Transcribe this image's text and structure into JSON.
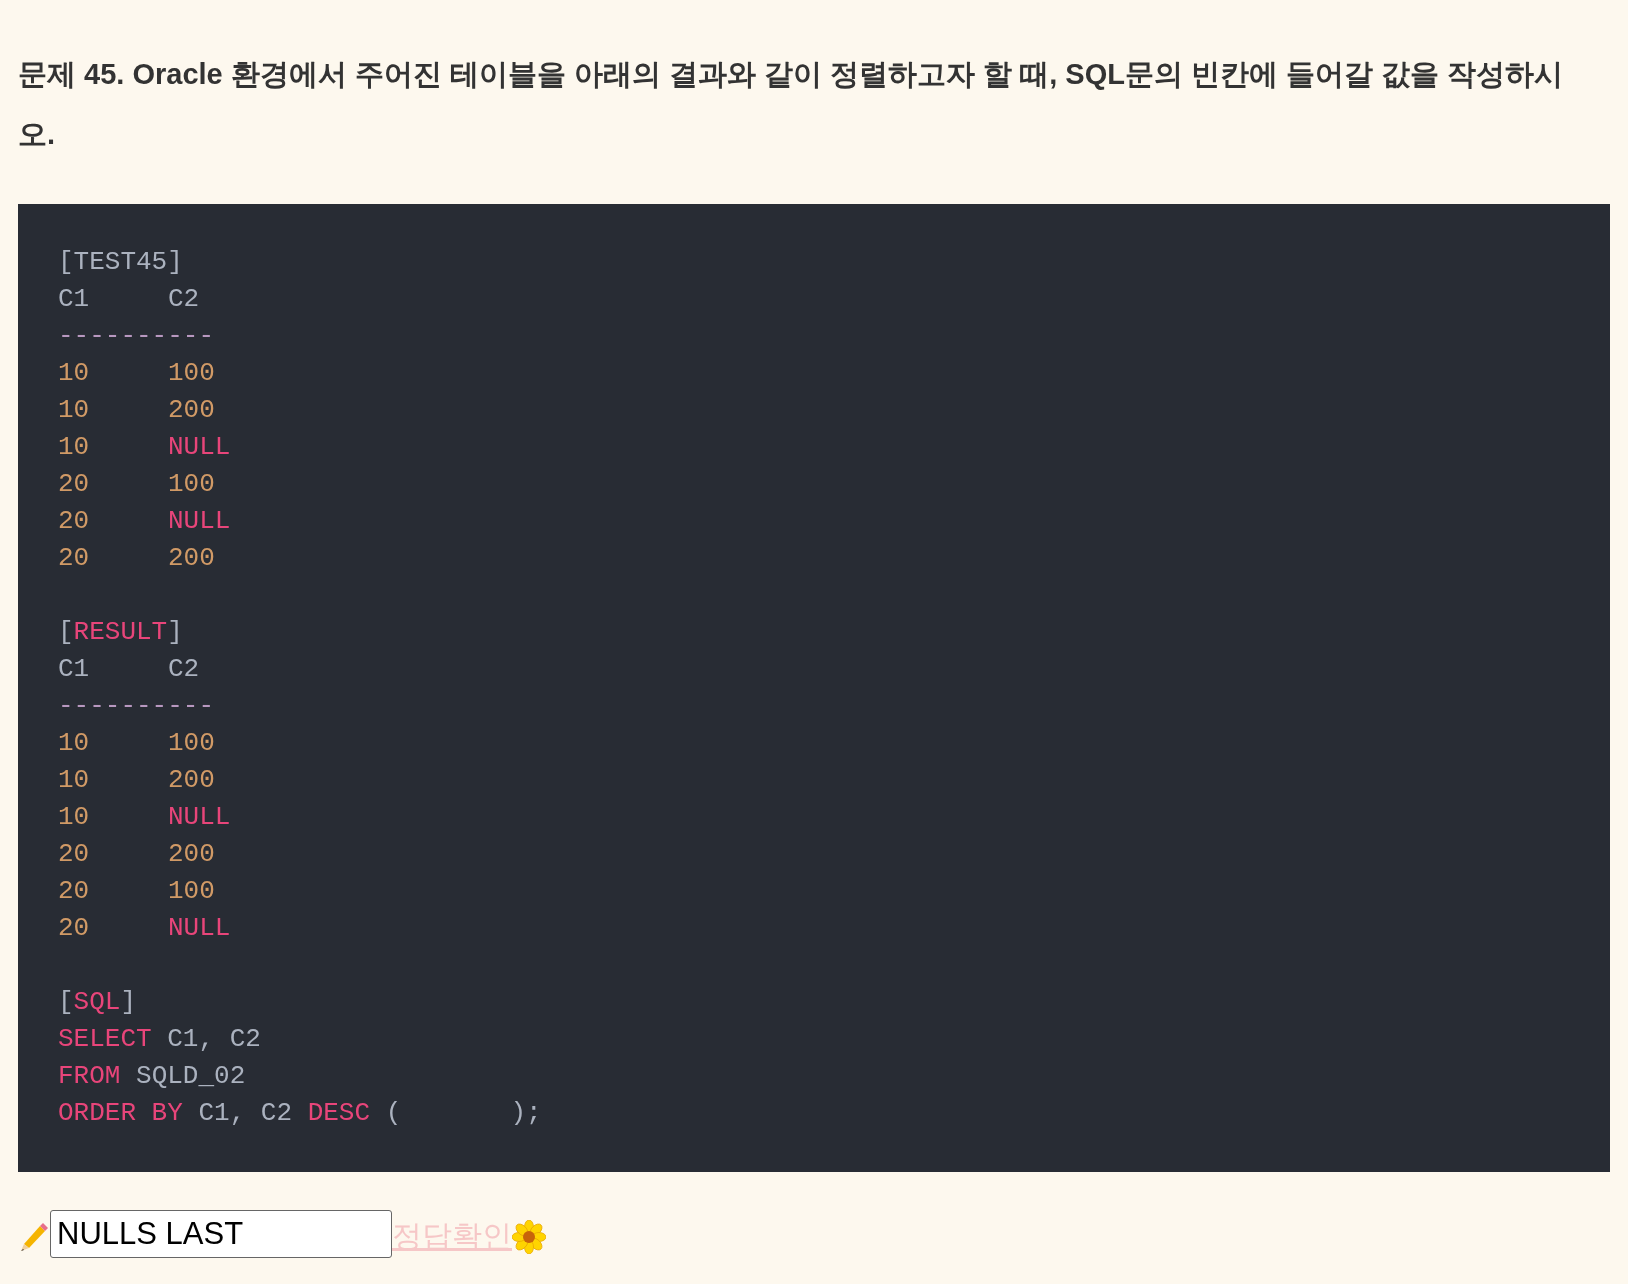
{
  "question": "문제 45. Oracle 환경에서 주어진 테이블을 아래의 결과와 같이 정렬하고자 할 때, SQL문의 빈칸에 들어갈 값을 작성하시오.",
  "sections": [
    {
      "kind": "table",
      "title": [
        {
          "text": "[",
          "kind": "plain"
        },
        {
          "text": "TEST45",
          "kind": "plain"
        },
        {
          "text": "]",
          "kind": "plain"
        }
      ],
      "columns": [
        "C1",
        "C2"
      ],
      "divider": "----------",
      "rows": [
        [
          {
            "text": "10",
            "kind": "number"
          },
          {
            "text": "100",
            "kind": "number"
          }
        ],
        [
          {
            "text": "10",
            "kind": "number"
          },
          {
            "text": "200",
            "kind": "number"
          }
        ],
        [
          {
            "text": "10",
            "kind": "number"
          },
          {
            "text": "NULL",
            "kind": "null"
          }
        ],
        [
          {
            "text": "20",
            "kind": "number"
          },
          {
            "text": "100",
            "kind": "number"
          }
        ],
        [
          {
            "text": "20",
            "kind": "number"
          },
          {
            "text": "NULL",
            "kind": "null"
          }
        ],
        [
          {
            "text": "20",
            "kind": "number"
          },
          {
            "text": "200",
            "kind": "number"
          }
        ]
      ]
    },
    {
      "kind": "table",
      "title": [
        {
          "text": "[",
          "kind": "plain"
        },
        {
          "text": "RESULT",
          "kind": "keyword"
        },
        {
          "text": "]",
          "kind": "plain"
        }
      ],
      "columns": [
        "C1",
        "C2"
      ],
      "divider": "----------",
      "rows": [
        [
          {
            "text": "10",
            "kind": "number"
          },
          {
            "text": "100",
            "kind": "number"
          }
        ],
        [
          {
            "text": "10",
            "kind": "number"
          },
          {
            "text": "200",
            "kind": "number"
          }
        ],
        [
          {
            "text": "10",
            "kind": "number"
          },
          {
            "text": "NULL",
            "kind": "null"
          }
        ],
        [
          {
            "text": "20",
            "kind": "number"
          },
          {
            "text": "200",
            "kind": "number"
          }
        ],
        [
          {
            "text": "20",
            "kind": "number"
          },
          {
            "text": "100",
            "kind": "number"
          }
        ],
        [
          {
            "text": "20",
            "kind": "number"
          },
          {
            "text": "NULL",
            "kind": "null"
          }
        ]
      ]
    },
    {
      "kind": "sql",
      "title": [
        {
          "text": "[",
          "kind": "plain"
        },
        {
          "text": "SQL",
          "kind": "keyword"
        },
        {
          "text": "]",
          "kind": "plain"
        }
      ],
      "lines": [
        [
          {
            "text": "SELECT",
            "kind": "keyword"
          },
          {
            "text": " C1, C2",
            "kind": "plain"
          }
        ],
        [
          {
            "text": "FROM",
            "kind": "keyword"
          },
          {
            "text": " SQLD_02",
            "kind": "plain"
          }
        ],
        [
          {
            "text": "ORDER BY",
            "kind": "keyword"
          },
          {
            "text": " C1, C2 ",
            "kind": "plain"
          },
          {
            "text": "DESC",
            "kind": "keyword"
          },
          {
            "text": " (       );",
            "kind": "plain"
          }
        ]
      ]
    }
  ],
  "answer": {
    "value": "NULLS LAST",
    "link": "정답확인"
  }
}
